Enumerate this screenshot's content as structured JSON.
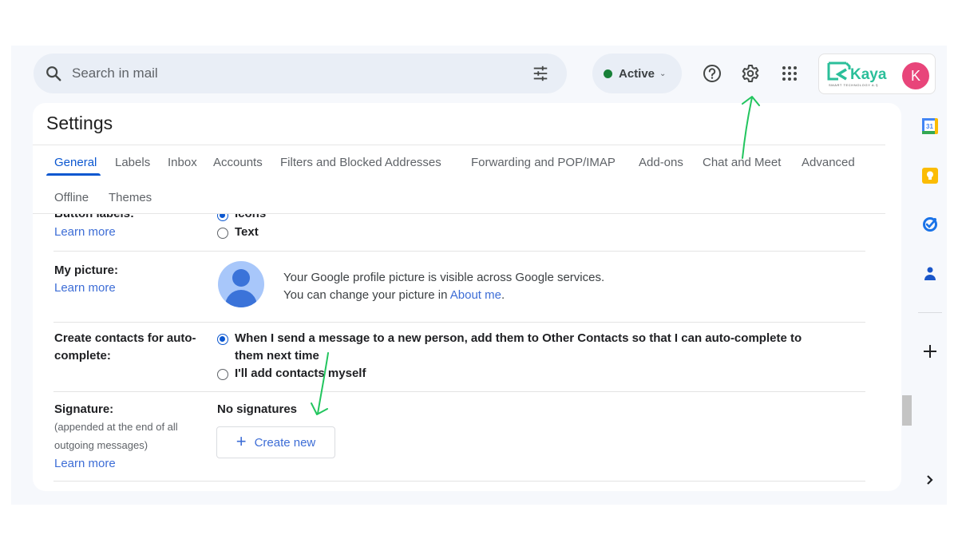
{
  "search": {
    "placeholder": "Search in mail",
    "value": ""
  },
  "status": {
    "label": "Active",
    "color": "#188038"
  },
  "header_icons": [
    "help-icon",
    "settings-gear-icon",
    "apps-grid-icon"
  ],
  "account": {
    "logo_text": "Kaya",
    "logo_subtitle": "SMART TECHNOLOGY A.Ş",
    "avatar_initial": "K",
    "avatar_color": "#e8457a",
    "brand_color": "#2bbf9a"
  },
  "settings": {
    "title": "Settings",
    "tabs": [
      {
        "label": "General",
        "active": true
      },
      {
        "label": "Labels"
      },
      {
        "label": "Inbox"
      },
      {
        "label": "Accounts"
      },
      {
        "label": "Filters and Blocked Addresses"
      },
      {
        "label": "Forwarding and POP/IMAP"
      },
      {
        "label": "Add-ons"
      },
      {
        "label": "Chat and Meet"
      },
      {
        "label": "Advanced"
      },
      {
        "label": "Offline"
      },
      {
        "label": "Themes"
      }
    ],
    "rows": {
      "button_labels": {
        "label": "Button labels:",
        "learn_more": "Learn more",
        "options": [
          {
            "label": "Icons",
            "selected": true
          },
          {
            "label": "Text",
            "selected": false
          }
        ]
      },
      "my_picture": {
        "label": "My picture:",
        "learn_more": "Learn more",
        "line1": "Your Google profile picture is visible across Google services.",
        "line2_prefix": "You can change your picture in ",
        "line2_link": "About me",
        "line2_suffix": "."
      },
      "create_contacts": {
        "label_line1": "Create contacts for auto-",
        "label_line2": "complete:",
        "options": [
          {
            "label_line1": "When I send a message to a new person, add them to Other Contacts so that I can auto-complete to",
            "label_line2": "them next time",
            "selected": true
          },
          {
            "label_line1": "I'll add contacts myself",
            "selected": false
          }
        ]
      },
      "signature": {
        "label": "Signature:",
        "sub_line1": "(appended at the end of all",
        "sub_line2": "outgoing messages)",
        "learn_more": "Learn more",
        "status": "No signatures",
        "create_button": "Create new"
      }
    }
  },
  "side_panel": {
    "calendar_day": "31",
    "items": [
      "calendar-icon",
      "keep-icon",
      "tasks-icon",
      "contacts-icon",
      "add-addon-icon",
      "expand-panel-icon"
    ]
  },
  "annotations": {
    "color": "#22c55e",
    "arrows": [
      "pointing-to-settings-gear",
      "pointing-to-create-new-signature"
    ]
  }
}
